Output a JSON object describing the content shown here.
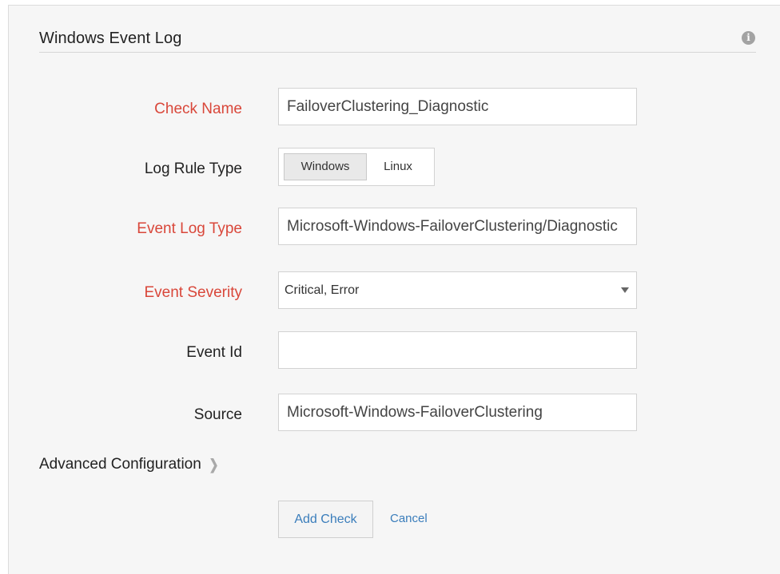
{
  "panel": {
    "title": "Windows Event Log",
    "info_icon": "info-icon"
  },
  "form": {
    "check_name": {
      "label": "Check Name",
      "value": "FailoverClustering_Diagnostic",
      "required": true
    },
    "log_rule_type": {
      "label": "Log Rule Type",
      "options": [
        "Windows",
        "Linux"
      ],
      "selected": "Windows"
    },
    "event_log_type": {
      "label": "Event Log Type",
      "value": "Microsoft-Windows-FailoverClustering/Diagnostic",
      "required": true
    },
    "event_severity": {
      "label": "Event Severity",
      "value": "Critical, Error",
      "required": true
    },
    "event_id": {
      "label": "Event Id",
      "value": ""
    },
    "source": {
      "label": "Source",
      "value": "Microsoft-Windows-FailoverClustering"
    }
  },
  "advanced": {
    "label": "Advanced Configuration",
    "icon": "chevron-right-icon"
  },
  "actions": {
    "add_label": "Add Check",
    "cancel_label": "Cancel"
  },
  "colors": {
    "required": "#d9473a",
    "link": "#3a7dbb",
    "panel_bg": "#f6f6f6"
  }
}
